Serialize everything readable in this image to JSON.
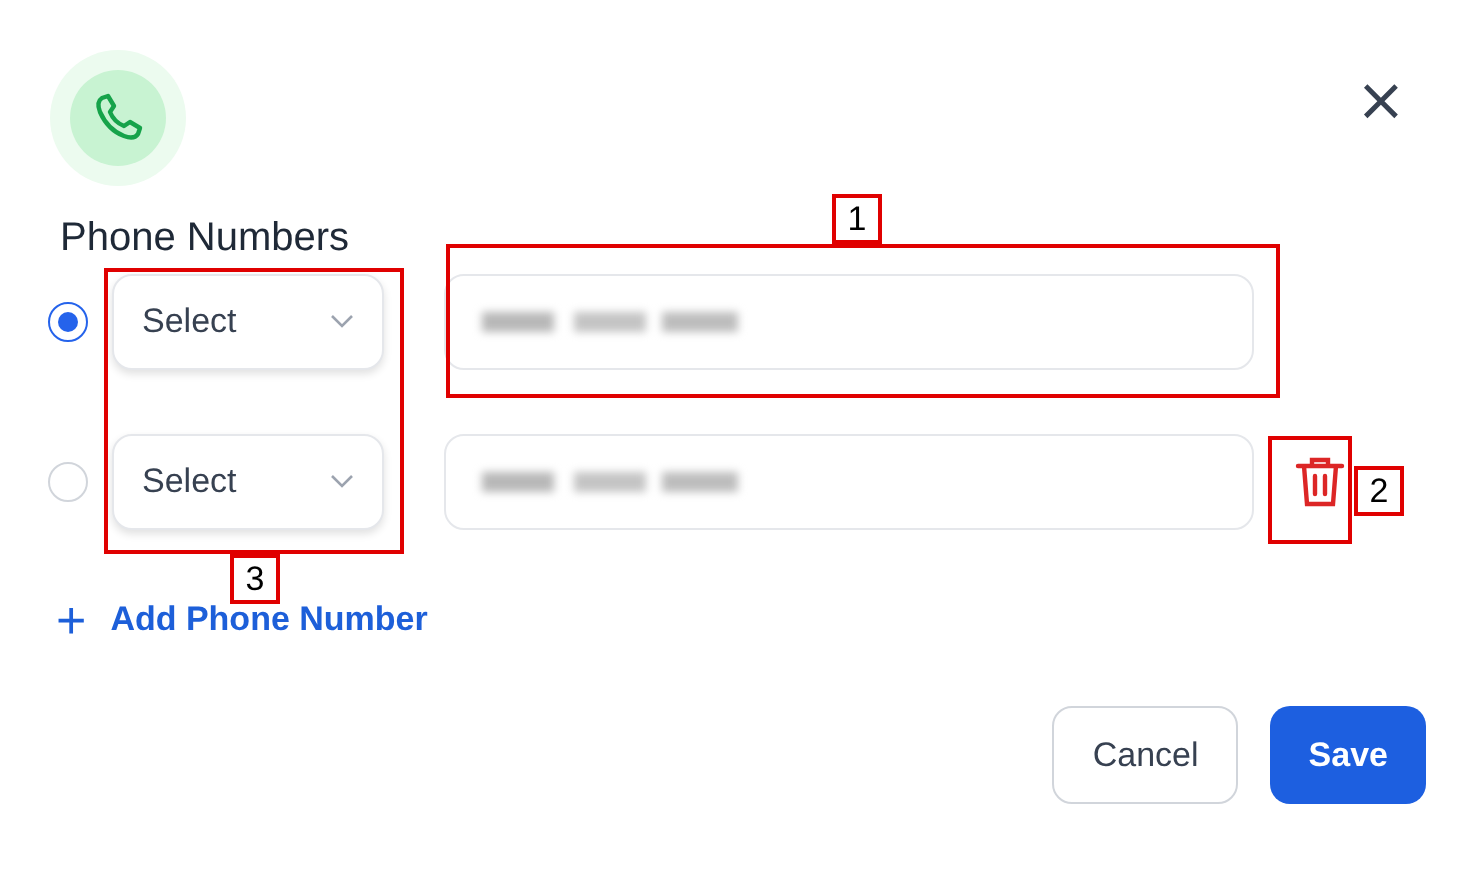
{
  "dialog": {
    "title": "Phone Numbers",
    "close": "×"
  },
  "phones": [
    {
      "selected": true,
      "type_placeholder": "Select",
      "removable": false
    },
    {
      "selected": false,
      "type_placeholder": "Select",
      "removable": true
    }
  ],
  "add_link": {
    "icon": "+",
    "label": "Add Phone Number"
  },
  "buttons": [
    {
      "label": "Cancel",
      "kind": "secondary"
    },
    {
      "label": "Save",
      "kind": "primary"
    }
  ],
  "annotations": [
    {
      "label": "1"
    },
    {
      "label": "2"
    },
    {
      "label": "3"
    }
  ]
}
